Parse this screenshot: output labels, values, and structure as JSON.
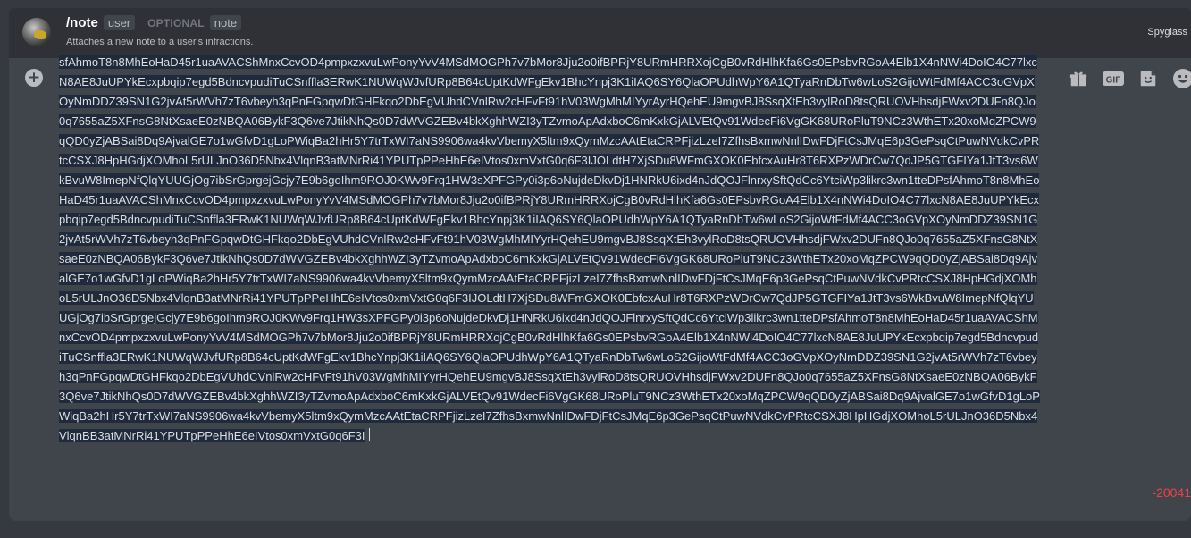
{
  "command": {
    "name": "/note",
    "param_required": "user",
    "optional_label": "OPTIONAL",
    "param_optional": "note",
    "description": "Attaches a new note to a user's infractions.",
    "app_name": "Spyglass"
  },
  "input": {
    "lines": [
      "sfAhmoT8n8MhEoHaD45r1uaAVACShMnxCcvOD4pmpxzxvuLwPonyYvV4MSdMOGPh7v7bMor8Jju2o0ifBPRjY8URmHRRXojCgB0vRdHlhKfa6Gs0EPsbvRGoA4El",
      "b1X4nNWi4DoIO4C77lxcN8AE8JuUPYkEcxpbqip7egd5BdncvpudiTuCSnffla3ERwK1NUWqWJvfURp8B64cUptKdWFgEkv1BhcYnpj3K1iIAQ6SY6QlaOPUdhWpY6A",
      "1QTyaRnDbTw6wLoS2GijoWtFdMf4ACC3oGVpXOyNmDDZ39SN1G2jvAt5rWVh7zT6vbeyh3qPnFGpqwDtGHFkqo2DbEgVUhdCVnlRw2cHFvFt91hV03WgMhMIYyrA",
      "yrHQehEU9mgvBJ8SsqXtEh3vylRoD8tsQRUOVHhsdjFWxv2DUFn8QJo0q7655aZ5XFnsG8NtXsaeE0zNBQA06BykF3Q6ve7JtikNhQs0D7dWVGZEBv4bkXghhWZI",
      "3yTZvmoApAdxboC6mKxkGjALVEtQv91WdecFi6VgGK68URoPluT9NCz3WthETx20xoMqZPCW9qQD0yZjABSai8Dq9AjvalGE7o1wGfvD1gLoPWiqBa2hHr5Y7trTx",
      "WI7aNS9906wa4kvVbemyX5ltm9xQymMzcAAtEtaCRPFjizLzeI7ZfhsBxmwNnlIDwFDjFtCsJMqE6p3GePsqCtPuwNVdkCvPRtcCSXJ8HpHGdjXOMhoL5rULJnO36D",
      "5Nbx4VlqnB3atMNrRi41YPUTpPPeHhE6eIVtos0xmVxtG0q6F3IJOLdtH7XjSDu8WFmGXOK0EbfcxAuHr8T6RXPzWDrCw7QdJP5GTGFIYa1JtT3vs6WkBvuW8Imep",
      "NfQlqYUUGjOg7ibSrGprgejGcjy7E9b6goIhm9ROJ0KWv9Frq1HW3sXPFGPy0i3p6oNujdeDkvDj1HNRkU6ixd4nJdQOJFlnrxySftQdCc6YtciWp3likrc3wn1tteDPsfAhm",
      "oT8n8MhEoHaD45r1uaAVACShMnxCcvOD4pmpxzxvuLwPonyYvV4MSdMOGPh7v7bMor8Jju2o0ifBPRjY8URmHRRXojCgB0vRdHlhKfa6Gs0EPsbvRGoA4Elb1X4n",
      "NWi4DoIO4C77lxcN8AE8JuUPYkEcxpbqip7egd5BdncvpudiTuCSnffla3ERwK1NUWqWJvfURp8B64cUptKdWFgEkv1BhcYnpj3K1iIAQ6SY6QlaOPUdhWpY6A1QTya",
      "RnDbTw6wLoS2GijoWtFdMf4ACC3oGVpXOyNmDDZ39SN1G2jvAt5rWVh7zT6vbeyh3qPnFGpqwDtGHFkqo2DbEgVUhdCVnlRw2cHFvFt91hV03WgMhMIYyrHQe",
      "hEU9mgvBJ8SsqXtEh3vylRoD8tsQRUOVHhsdjFWxv2DUFn8QJo0q7655aZ5XFnsG8NtXsaeE0zNBQA06BykF3Q6ve7JtikNhQs0D7dWVGZEBv4bkXghhWZI3yTZv",
      "moApAdxboC6mKxkGjALVEtQv91WdecFi6VgGK68URoPluT9NCz3WthETx20xoMqZPCW9qQD0yZjABSai8Dq9AjvalGE7o1wGfvD1gLoPWiqBa2hHr5Y7trTxWI7a",
      "NS9906wa4kvVbemyX5ltm9xQymMzcAAtEtaCRPFjizLzeI7ZfhsBxmwNnlIDwFDjFtCsJMqE6p3GePsqCtPuwNVdkCvPRtcCSXJ8HpHGdjXOMhoL5rULJnO36D5Nbx",
      "4VlqnB3atMNrRi41YPUTpPPeHhE6eIVtos0xmVxtG0q6F3IJOLdtH7XjSDu8WFmGXOK0EbfcxAuHr8T6RXPzWDrCw7QdJP5GTGFIYa1JtT3vs6WkBvuW8ImepNfQl",
      "qYUUGjOg7ibSrGprgejGcjy7E9b6goIhm9ROJ0KWv9Frq1HW3sXPFGPy0i3p6oNujdeDkvDj1HNRkU6ixd4nJdQOJFlnrxySftQdCc6YtciWp3likrc3wn1tteDPsfAhmoT8",
      "n8MhEoHaD45r1uaAVACShMnxCcvOD4pmpxzxvuLwPonyYvV4MSdMOGPh7v7bMor8Jju2o0ifBPRjY8URmHRRXojCgB0vRdHlhKfa6Gs0EPsbvRGoA4Elb1X4nNW",
      "i4DoIO4C77lxcN8AE8JuUPYkEcxpbqip7egd5BdncvpudiTuCSnffla3ERwK1NUWqWJvfURp8B64cUptKdWFgEkv1BhcYnpj3K1iIAQ6SY6QlaOPUdhWpY6A1QTyaRnD",
      "bTw6wLoS2GijoWtFdMf4ACC3oGVpXOyNmDDZ39SN1G2jvAt5rWVh7zT6vbeyh3qPnFGpqwDtGHFkqo2DbEgVUhdCVnlRw2cHFvFt91hV03WgMhMIYyrHQehEU",
      "9mgvBJ8SsqXtEh3vylRoD8tsQRUOVHhsdjFWxv2DUFn8QJo0q7655aZ5XFnsG8NtXsaeE0zNBQA06BykF3Q6ve7JtikNhQs0D7dWVGZEBv4bkXghhWZI3yTZvmoA",
      "pAdxboC6mKxkGjALVEtQv91WdecFi6VgGK68URoPluT9NCz3WthETx20xoMqZPCW9qQD0yZjABSai8Dq9AjvalGE7o1wGfvD1gLoPWiqBa2hHr5Y7trTxWI7aNS99",
      "06wa4kvVbemyX5ltm9xQymMzcAAtEtaCRPFjizLzeI7ZfhsBxmwNnlIDwFDjFtCsJMqE6p3GePsqCtPuwNVdkCvPRtcCSXJ8HpHGdjXOMhoL5rULJnO36D5Nbx4VlqnB",
      "B3atMNrRi41YPUTpPPeHhE6eIVtos0xmVxtG0q6F3I"
    ],
    "char_counter": "-20041"
  },
  "icons": {
    "attach": "plus-circle-icon",
    "gift": "gift-icon",
    "gif": "gif-icon",
    "gif_label": "GIF",
    "sticker": "sticker-icon",
    "emoji": "emoji-icon"
  },
  "colors": {
    "background": "#36393f",
    "header": "#2f3136",
    "input": "#40444b",
    "selection": "#1f2a3c",
    "counter": "#ed4245"
  }
}
